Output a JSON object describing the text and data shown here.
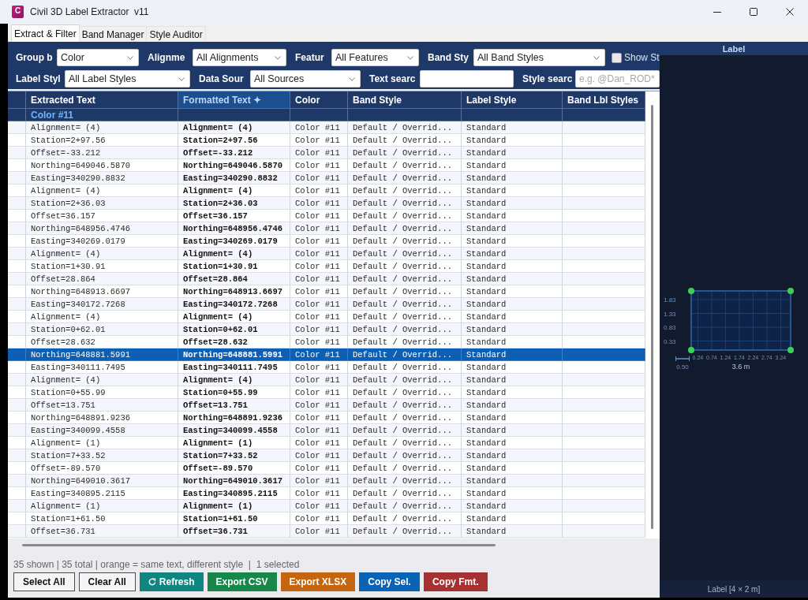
{
  "window": {
    "icon_letter": "C",
    "title": "Civil 3D Label Extractor  v11"
  },
  "tabs": [
    {
      "label": "Extract & Filter",
      "selected": true
    },
    {
      "label": "Band Manager",
      "selected": false
    },
    {
      "label": "Style Auditor",
      "selected": false
    }
  ],
  "filters": {
    "row_1": [
      {
        "kind": "dropdown",
        "label": "Group b",
        "value": "Color"
      },
      {
        "kind": "dropdown",
        "label": "Alignme",
        "value": "All Alignments"
      },
      {
        "kind": "dropdown",
        "label": "Featur",
        "value": "All Features"
      },
      {
        "kind": "dropdown",
        "label": "Band Sty",
        "value": "All Band Styles"
      },
      {
        "kind": "checkbox",
        "label": "Show St",
        "checked": false
      }
    ],
    "row_2": [
      {
        "kind": "dropdown",
        "label": "Label Styl",
        "value": "All Label Styles"
      },
      {
        "kind": "dropdown",
        "label": "Data Sour",
        "value": "All Sources"
      },
      {
        "kind": "text",
        "label": "Text searc"
      },
      {
        "kind": "text",
        "label": "Style searc",
        "placeholder": "e.g. @Dan_ROD*"
      }
    ]
  },
  "table": {
    "columns": [
      {
        "label": "Extracted Text",
        "active": false
      },
      {
        "label": "Formatted Text ✦",
        "active": true
      },
      {
        "label": "Color",
        "active": false
      },
      {
        "label": "Band Style",
        "active": false
      },
      {
        "label": "Label Style",
        "active": false
      },
      {
        "label": "Band Lbl Styles",
        "active": false
      }
    ],
    "group": {
      "label": "Color #11"
    },
    "rows": [
      {
        "extracted": "Alignment= (4)",
        "formatted": "Alignment= (4)",
        "color_group": "Color #11",
        "band_style": "Default / Overrid...",
        "label_style": "Standard",
        "selected": false
      },
      {
        "extracted": "Station=2+97.56",
        "formatted": "Station=2+97.56",
        "color_group": "Color #11",
        "band_style": "Default / Overrid...",
        "label_style": "Standard",
        "selected": false
      },
      {
        "extracted": "Offset=-33.212",
        "formatted": "Offset=-33.212",
        "color_group": "Color #11",
        "band_style": "Default / Overrid...",
        "label_style": "Standard",
        "selected": false
      },
      {
        "extracted": "Northing=649046.5870",
        "formatted": "Northing=649046.5870",
        "color_group": "Color #11",
        "band_style": "Default / Overrid...",
        "label_style": "Standard",
        "selected": false
      },
      {
        "extracted": "Easting=340290.8832",
        "formatted": "Easting=340290.8832",
        "color_group": "Color #11",
        "band_style": "Default / Overrid...",
        "label_style": "Standard",
        "selected": false
      },
      {
        "extracted": "Alignment= (4)",
        "formatted": "Alignment= (4)",
        "color_group": "Color #11",
        "band_style": "Default / Overrid...",
        "label_style": "Standard",
        "selected": false
      },
      {
        "extracted": "Station=2+36.03",
        "formatted": "Station=2+36.03",
        "color_group": "Color #11",
        "band_style": "Default / Overrid...",
        "label_style": "Standard",
        "selected": false
      },
      {
        "extracted": "Offset=36.157",
        "formatted": "Offset=36.157",
        "color_group": "Color #11",
        "band_style": "Default / Overrid...",
        "label_style": "Standard",
        "selected": false
      },
      {
        "extracted": "Northing=648956.4746",
        "formatted": "Northing=648956.4746",
        "color_group": "Color #11",
        "band_style": "Default / Overrid...",
        "label_style": "Standard",
        "selected": false
      },
      {
        "extracted": "Easting=340269.0179",
        "formatted": "Easting=340269.0179",
        "color_group": "Color #11",
        "band_style": "Default / Overrid...",
        "label_style": "Standard",
        "selected": false
      },
      {
        "extracted": "Alignment= (4)",
        "formatted": "Alignment= (4)",
        "color_group": "Color #11",
        "band_style": "Default / Overrid...",
        "label_style": "Standard",
        "selected": false
      },
      {
        "extracted": "Station=1+30.91",
        "formatted": "Station=1+30.91",
        "color_group": "Color #11",
        "band_style": "Default / Overrid...",
        "label_style": "Standard",
        "selected": false
      },
      {
        "extracted": "Offset=28.864",
        "formatted": "Offset=28.864",
        "color_group": "Color #11",
        "band_style": "Default / Overrid...",
        "label_style": "Standard",
        "selected": false
      },
      {
        "extracted": "Northing=648913.6697",
        "formatted": "Northing=648913.6697",
        "color_group": "Color #11",
        "band_style": "Default / Overrid...",
        "label_style": "Standard",
        "selected": false
      },
      {
        "extracted": "Easting=340172.7268",
        "formatted": "Easting=340172.7268",
        "color_group": "Color #11",
        "band_style": "Default / Overrid...",
        "label_style": "Standard",
        "selected": false
      },
      {
        "extracted": "Alignment= (4)",
        "formatted": "Alignment= (4)",
        "color_group": "Color #11",
        "band_style": "Default / Overrid...",
        "label_style": "Standard",
        "selected": false
      },
      {
        "extracted": "Station=0+62.01",
        "formatted": "Station=0+62.01",
        "color_group": "Color #11",
        "band_style": "Default / Overrid...",
        "label_style": "Standard",
        "selected": false
      },
      {
        "extracted": "Offset=28.632",
        "formatted": "Offset=28.632",
        "color_group": "Color #11",
        "band_style": "Default / Overrid...",
        "label_style": "Standard",
        "selected": false
      },
      {
        "extracted": "Northing=648881.5991",
        "formatted": "Northing=648881.5991",
        "color_group": "Color #11",
        "band_style": "Default / Overrid...",
        "label_style": "Standard",
        "selected": true
      },
      {
        "extracted": "Easting=340111.7495",
        "formatted": "Easting=340111.7495",
        "color_group": "Color #11",
        "band_style": "Default / Overrid...",
        "label_style": "Standard",
        "selected": false
      },
      {
        "extracted": "Alignment= (4)",
        "formatted": "Alignment= (4)",
        "color_group": "Color #11",
        "band_style": "Default / Overrid...",
        "label_style": "Standard",
        "selected": false
      },
      {
        "extracted": "Station=0+55.99",
        "formatted": "Station=0+55.99",
        "color_group": "Color #11",
        "band_style": "Default / Overrid...",
        "label_style": "Standard",
        "selected": false
      },
      {
        "extracted": "Offset=13.751",
        "formatted": "Offset=13.751",
        "color_group": "Color #11",
        "band_style": "Default / Overrid...",
        "label_style": "Standard",
        "selected": false
      },
      {
        "extracted": "Northing=648891.9236",
        "formatted": "Northing=648891.9236",
        "color_group": "Color #11",
        "band_style": "Default / Overrid...",
        "label_style": "Standard",
        "selected": false
      },
      {
        "extracted": "Easting=340099.4558",
        "formatted": "Easting=340099.4558",
        "color_group": "Color #11",
        "band_style": "Default / Overrid...",
        "label_style": "Standard",
        "selected": false
      },
      {
        "extracted": "Alignment= (1)",
        "formatted": "Alignment= (1)",
        "color_group": "Color #11",
        "band_style": "Default / Overrid...",
        "label_style": "Standard",
        "selected": false
      },
      {
        "extracted": "Station=7+33.52",
        "formatted": "Station=7+33.52",
        "color_group": "Color #11",
        "band_style": "Default / Overrid...",
        "label_style": "Standard",
        "selected": false
      },
      {
        "extracted": "Offset=-89.570",
        "formatted": "Offset=-89.570",
        "color_group": "Color #11",
        "band_style": "Default / Overrid...",
        "label_style": "Standard",
        "selected": false
      },
      {
        "extracted": "Northing=649010.3617",
        "formatted": "Northing=649010.3617",
        "color_group": "Color #11",
        "band_style": "Default / Overrid...",
        "label_style": "Standard",
        "selected": false
      },
      {
        "extracted": "Easting=340895.2115",
        "formatted": "Easting=340895.2115",
        "color_group": "Color #11",
        "band_style": "Default / Overrid...",
        "label_style": "Standard",
        "selected": false
      },
      {
        "extracted": "Alignment= (1)",
        "formatted": "Alignment= (1)",
        "color_group": "Color #11",
        "band_style": "Default / Overrid...",
        "label_style": "Standard",
        "selected": false
      },
      {
        "extracted": "Station=1+61.50",
        "formatted": "Station=1+61.50",
        "color_group": "Color #11",
        "band_style": "Default / Overrid...",
        "label_style": "Standard",
        "selected": false
      },
      {
        "extracted": "Offset=36.731",
        "formatted": "Offset=36.731",
        "color_group": "Color #11",
        "band_style": "Default / Overrid...",
        "label_style": "Standard",
        "selected": false
      }
    ]
  },
  "status_bar": "35 shown | 35 total | orange = same text, different style  |  1 selected",
  "buttons": [
    {
      "label": "Select All",
      "kind": "outline"
    },
    {
      "label": "Clear All",
      "kind": "outline"
    },
    {
      "label": "Refresh",
      "kind": "refresh",
      "color": "#11857f"
    },
    {
      "label": "Export CSV",
      "kind": "filled",
      "color": "#1a874a"
    },
    {
      "label": "Export XLSX",
      "kind": "filled",
      "color": "#c4650f"
    },
    {
      "label": "Copy Sel.",
      "kind": "filled",
      "color": "#0b63b6"
    },
    {
      "label": "Copy Fmt.",
      "kind": "filled",
      "color": "#a53133"
    }
  ],
  "preview": {
    "title": "Label",
    "y_ticks": [
      "1.83",
      "1.33",
      "0.83",
      "0.33"
    ],
    "x_ticks": [
      "0.24",
      "0.74",
      "1.24",
      "1.74",
      "2.24",
      "2.74",
      "3.24"
    ],
    "width_label": "3.6 m",
    "scale_label": "0.50",
    "footer": "Label [4 × 2 m]"
  }
}
